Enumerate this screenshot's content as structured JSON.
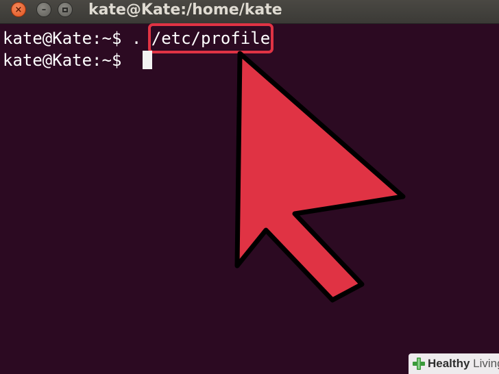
{
  "window": {
    "title": "kate@Kate:/home/kate",
    "close_glyph": "×",
    "minimize_glyph": "–"
  },
  "terminal": {
    "lines": [
      {
        "prompt": "kate@Kate:~$ ",
        "command_prefix": ". ",
        "command_highlighted": "/etc/profile"
      },
      {
        "prompt": "kate@Kate:~$ "
      }
    ],
    "background_color": "#2c0a22",
    "text_color": "#ffffff"
  },
  "annotation": {
    "highlight_color": "#e03344",
    "arrow_color": "#e03344"
  },
  "watermark": {
    "brand_strong": "Healthy",
    "brand_light": " Living",
    "icon": "cross-plus-icon"
  }
}
